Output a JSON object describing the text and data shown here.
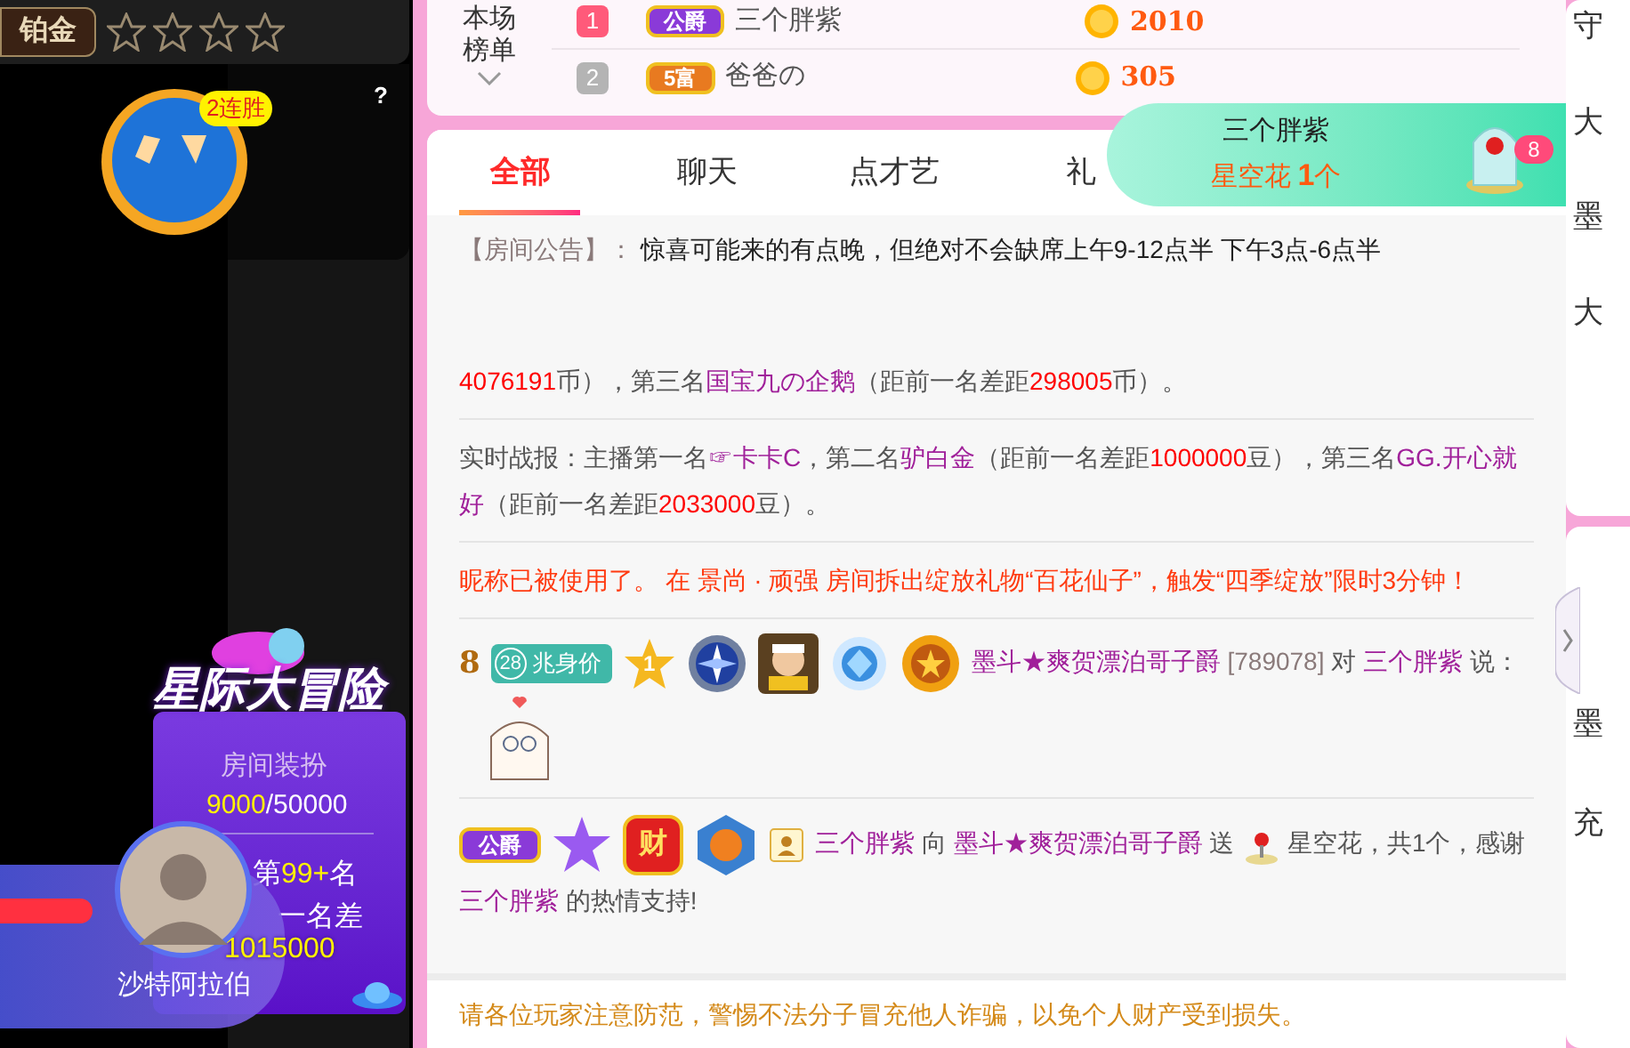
{
  "stream_panel": {
    "tier": "铂金",
    "stars": 0,
    "pk_streak": "2连胜",
    "help": "?",
    "event": {
      "title": "星际大冒险",
      "decor_label": "房间装扮",
      "decor_current": "9000",
      "decor_total": "/50000",
      "rank_prefix": "第",
      "rank_value": "99+",
      "rank_suffix": "名",
      "gap_label": "一名差",
      "gap_value": "1015000"
    },
    "host_name": "沙特阿拉伯"
  },
  "leaderboard": {
    "title": "本场榜单",
    "rows": [
      {
        "rank": "1",
        "color": "#ff5a7a",
        "title": {
          "text": "公爵",
          "color": "#8a3ad8"
        },
        "name": "三个胖紫",
        "amount": "2010"
      },
      {
        "rank": "2",
        "color": "#b4b4b4",
        "title": {
          "text": "5富",
          "color": "#e87a20"
        },
        "name": "爸爸の",
        "amount": "305"
      }
    ]
  },
  "tabs": [
    {
      "label": "全部",
      "selected": true
    },
    {
      "label": "聊天",
      "selected": false
    },
    {
      "label": "点才艺",
      "selected": false
    },
    {
      "label": "礼",
      "selected": false
    }
  ],
  "gift_popup": {
    "sender": "三个胖紫",
    "gift": "星空花",
    "count": "1",
    "unit": "个",
    "badge": "8"
  },
  "messages": [
    {
      "kind": "notice",
      "segments": [
        {
          "kind": "meta",
          "text": "【房间公告】："
        },
        {
          "kind": "strong",
          "text": " 惊喜可能来的有点晚，但绝对不会缺席上午9-12点半 下午3点-6点半"
        }
      ]
    },
    {
      "kind": "report",
      "segments": [
        {
          "kind": "num",
          "text": "4076191"
        },
        {
          "kind": "plain",
          "text": "币），第三名"
        },
        {
          "kind": "name",
          "text": "国宝九の企鹅"
        },
        {
          "kind": "plain",
          "text": "（距前一名差距"
        },
        {
          "kind": "num",
          "text": "298005"
        },
        {
          "kind": "plain",
          "text": "币）。"
        }
      ]
    },
    {
      "kind": "report",
      "segments": [
        {
          "kind": "plain",
          "text": "实时战报：主播第一名"
        },
        {
          "kind": "name",
          "text": "☞卡卡C"
        },
        {
          "kind": "plain",
          "text": "，第二名"
        },
        {
          "kind": "name",
          "text": "驴白金"
        },
        {
          "kind": "plain",
          "text": "（距前一名差距"
        },
        {
          "kind": "num",
          "text": "1000000"
        },
        {
          "kind": "plain",
          "text": "豆），第三名"
        },
        {
          "kind": "name",
          "text": "GG.开心就好"
        },
        {
          "kind": "plain",
          "text": "（距前一名差距"
        },
        {
          "kind": "num",
          "text": "2033000"
        },
        {
          "kind": "plain",
          "text": "豆）。"
        }
      ]
    },
    {
      "kind": "system",
      "segments": [
        {
          "kind": "alert",
          "text": "昵称已被使用了。 在 景尚 · 顽强 房间拆出绽放礼物“百花仙子”，触发“四季绽放”限时3分钟！"
        }
      ]
    },
    {
      "kind": "chat",
      "badges": [
        {
          "kind": "level",
          "text": "8"
        },
        {
          "kind": "worth",
          "number": "28",
          "text": "兆身价"
        },
        {
          "kind": "star",
          "text": "1"
        },
        {
          "kind": "compass"
        },
        {
          "kind": "portrait"
        },
        {
          "kind": "gem"
        },
        {
          "kind": "medal"
        }
      ],
      "segments": [
        {
          "kind": "name",
          "text": "墨斗★爽贺漂泊哥子爵"
        },
        {
          "kind": "meta",
          "text": " [789078] "
        },
        {
          "kind": "plain",
          "text": "对 "
        },
        {
          "kind": "name",
          "text": "三个胖紫"
        },
        {
          "kind": "plain",
          "text": " 说："
        },
        {
          "kind": "sticker"
        }
      ]
    },
    {
      "kind": "gift",
      "badges": [
        {
          "kind": "title",
          "text": "公爵"
        },
        {
          "kind": "purple-star"
        },
        {
          "kind": "wealth",
          "text": "财"
        },
        {
          "kind": "drum"
        },
        {
          "kind": "user"
        }
      ],
      "segments": [
        {
          "kind": "name",
          "text": "三个胖紫"
        },
        {
          "kind": "plain",
          "text": " 向 "
        },
        {
          "kind": "name",
          "text": "墨斗★爽贺漂泊哥子爵"
        },
        {
          "kind": "plain",
          "text": " 送 "
        },
        {
          "kind": "gift-icon"
        },
        {
          "kind": "plain",
          "text": " 星空花，共1个，感谢 "
        },
        {
          "kind": "name",
          "text": "三个胖紫"
        },
        {
          "kind": "plain",
          "text": " 的热情支持!"
        }
      ]
    }
  ],
  "safety_notice": "请各位玩家注意防范，警惕不法分子冒充他人诈骗，以免个人财产受到损失。",
  "side_strip": [
    "守",
    "大",
    "墨",
    "大",
    "墨",
    "充"
  ]
}
